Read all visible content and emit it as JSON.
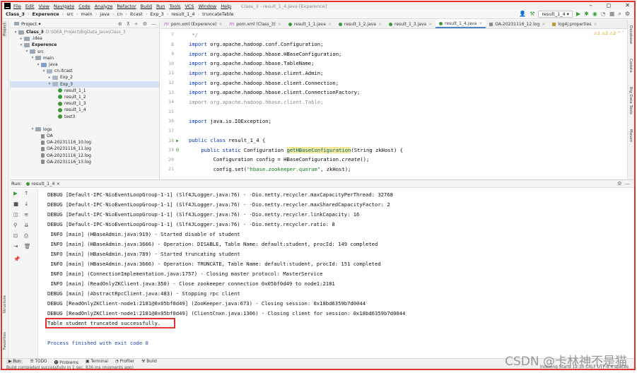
{
  "menubar": {
    "items": [
      "File",
      "Edit",
      "View",
      "Navigate",
      "Code",
      "Analyze",
      "Refactor",
      "Build",
      "Run",
      "Tools",
      "VCS",
      "Window",
      "Help"
    ],
    "window_title": "Class_3 - result_1_4.java [Experence]"
  },
  "navbar": {
    "crumbs": [
      "Class_3",
      "Experence",
      "src",
      "main",
      "java",
      "cn",
      "itcast",
      "Exp_3",
      "result_1_4",
      "truncateTable"
    ],
    "run_config": "result_1_4"
  },
  "left_strip": {
    "project": "Project",
    "structure": "Structure",
    "favorites": "Favorites"
  },
  "right_strip": {
    "database": "Database",
    "codota": "Codota",
    "big_data": "Big Data Tools",
    "maven": "Maven"
  },
  "project_panel": {
    "title": "Project",
    "tree": [
      {
        "label": "Class_3",
        "sub": "D:\\IDEA_Project\\BigData_Java\\Class_3",
        "icon": "folder",
        "arrow": "▾",
        "indent": 0,
        "bold": true
      },
      {
        "label": ".idea",
        "icon": "folder",
        "arrow": "▸",
        "indent": 1
      },
      {
        "label": "Experence",
        "icon": "folder",
        "arrow": "▾",
        "indent": 1,
        "bold": true
      },
      {
        "label": "src",
        "icon": "folder",
        "arrow": "▾",
        "indent": 2
      },
      {
        "label": "main",
        "icon": "folder",
        "arrow": "▾",
        "indent": 3
      },
      {
        "label": "java",
        "icon": "folder-blue",
        "arrow": "▾",
        "indent": 4
      },
      {
        "label": "cn.itcast",
        "icon": "pkg",
        "arrow": "▾",
        "indent": 5
      },
      {
        "label": "Exp_2",
        "icon": "pkg",
        "arrow": "▸",
        "indent": 6
      },
      {
        "label": "Exp_3",
        "icon": "pkg",
        "arrow": "▾",
        "indent": 6,
        "selected": true
      },
      {
        "label": "result_1_1",
        "icon": "java",
        "arrow": "",
        "indent": 7
      },
      {
        "label": "result_1_2",
        "icon": "java",
        "arrow": "",
        "indent": 7
      },
      {
        "label": "result_1_3",
        "icon": "java",
        "arrow": "",
        "indent": 7
      },
      {
        "label": "result_1_4",
        "icon": "java",
        "arrow": "",
        "indent": 7
      },
      {
        "label": "test3",
        "icon": "java",
        "arrow": "",
        "indent": 7
      },
      {
        "label": "",
        "icon": "",
        "arrow": "",
        "indent": 7
      },
      {
        "label": "logs",
        "icon": "folder",
        "arrow": "▾",
        "indent": 3
      },
      {
        "label": "OA",
        "icon": "log",
        "arrow": "",
        "indent": 4
      },
      {
        "label": "OA-20231116_10.log",
        "icon": "log",
        "arrow": "",
        "indent": 4
      },
      {
        "label": "OA-20231116_11.log",
        "icon": "log",
        "arrow": "",
        "indent": 4
      },
      {
        "label": "OA-20231116_12.log",
        "icon": "log",
        "arrow": "",
        "indent": 4
      },
      {
        "label": "OA-20231116_13.log",
        "icon": "log",
        "arrow": "",
        "indent": 4
      }
    ]
  },
  "editor": {
    "tabs": [
      {
        "label": "pom.xml (Experence)",
        "icon": "m"
      },
      {
        "label": "pom.xml (Class_3)",
        "icon": "m"
      },
      {
        "label": "result_1_1.java",
        "icon": "java"
      },
      {
        "label": "result_1_2.java",
        "icon": "java"
      },
      {
        "label": "result_1_3.java",
        "icon": "java"
      },
      {
        "label": "result_1_4.java",
        "icon": "java",
        "active": true
      },
      {
        "label": "OA-20231116_12.log",
        "icon": "lg"
      },
      {
        "label": "log4j.properties",
        "icon": "pr"
      }
    ],
    "inspections": "⚠1 ⚠2 ⚠2 ^ ˅",
    "lines": [
      {
        "n": "7",
        "mark": "",
        "html": "<span class=\"comment\"> */</span>"
      },
      {
        "n": "8",
        "mark": "",
        "html": "<span class=\"kw\">import</span> org.apache.hadoop.conf.Configuration;"
      },
      {
        "n": "9",
        "mark": "",
        "html": "<span class=\"kw\">import</span> org.apache.hadoop.hbase.HBaseConfiguration;"
      },
      {
        "n": "10",
        "mark": "",
        "html": "<span class=\"kw\">import</span> org.apache.hadoop.hbase.TableName;"
      },
      {
        "n": "11",
        "mark": "",
        "html": "<span class=\"kw\">import</span> org.apache.hadoop.hbase.client.Admin;"
      },
      {
        "n": "12",
        "mark": "",
        "html": "<span class=\"kw\">import</span> org.apache.hadoop.hbase.client.Connection;"
      },
      {
        "n": "13",
        "mark": "",
        "html": "<span class=\"kw\">import</span> org.apache.hadoop.hbase.client.ConnectionFactory;"
      },
      {
        "n": "14",
        "mark": "",
        "html": "<span class=\"dim\">import org.apache.hadoop.hbase.client.Table;</span>"
      },
      {
        "n": "15",
        "mark": "",
        "html": ""
      },
      {
        "n": "16",
        "mark": "",
        "html": "<span class=\"kw\">import</span> java.io.IOException;"
      },
      {
        "n": "17",
        "mark": "",
        "html": ""
      },
      {
        "n": "18",
        "mark": "▶",
        "html": "<span class=\"kw\">public class</span> result_1_4 {"
      },
      {
        "n": "19",
        "mark": "@",
        "html": "    <span class=\"kw\">public static</span> Configuration <span class=\"fn\">getHBaseConfiguration</span>(String zkHost) {"
      },
      {
        "n": "20",
        "mark": "",
        "html": "        Configuration config = HBaseConfiguration.<span class=\"it\">create</span>();"
      },
      {
        "n": "21",
        "mark": "",
        "html": "        config.set(<span class=\"str\">\"hbase.zookeeper.quorum\"</span>, zkHost);"
      }
    ]
  },
  "run_panel": {
    "label": "Run:",
    "tab": "result_1_4",
    "lines": [
      "DEBUG [Default-IPC-NioEventLoopGroup-1-1] (Slf4JLogger.java:76) - -Dio.netty.recycler.maxCapacityPerThread: 32768",
      "DEBUG [Default-IPC-NioEventLoopGroup-1-1] (Slf4JLogger.java:76) - -Dio.netty.recycler.maxSharedCapacityFactor: 2",
      "DEBUG [Default-IPC-NioEventLoopGroup-1-1] (Slf4JLogger.java:76) - -Dio.netty.recycler.linkCapacity: 16",
      "DEBUG [Default-IPC-NioEventLoopGroup-1-1] (Slf4JLogger.java:76) - -Dio.netty.recycler.ratio: 8",
      " INFO [main] (HBaseAdmin.java:919) - Started disable of student",
      " INFO [main] (HBaseAdmin.java:3666) - Operation: DISABLE, Table Name: default:student, procId: 149 completed",
      " INFO [main] (HBaseAdmin.java:789) - Started truncating student",
      " INFO [main] (HBaseAdmin.java:3666) - Operation: TRUNCATE, Table Name: default:student, procId: 151 completed",
      " INFO [main] (ConnectionImplementation.java:1757) - Closing master protocol: MasterService",
      " INFO [main] (ReadOnlyZKClient.java:350) - Close zookeeper connection 0x05bf0d49 to node1:2181",
      "DEBUG [main] (AbstractRpcClient.java:483) - Stopping rpc client",
      "DEBUG [ReadOnlyZKClient-node1:2181@0x05bf0d49] (ZooKeeper.java:673) - Closing session: 0x18bd6359b7d0044",
      "DEBUG [ReadOnlyZKClient-node1:2181@0x05bf0d49] (ClientCnxn.java:1306) - Closing client for session: 0x18bd6359b7d0044",
      "Table student truncated successfully.",
      "",
      "Process finished with exit code 0"
    ]
  },
  "bottom_tabs": [
    "Run",
    "TODO",
    "Problems",
    "Terminal",
    "Profiler",
    "Build"
  ],
  "status": {
    "left": "Build completed successfully in 1 sec, 836 ms (moments ago)",
    "right": "Indexing Starts  12:10  CRLF  UTF-8  4 spaces"
  },
  "watermark": "CSDN @卡林神不是猫"
}
